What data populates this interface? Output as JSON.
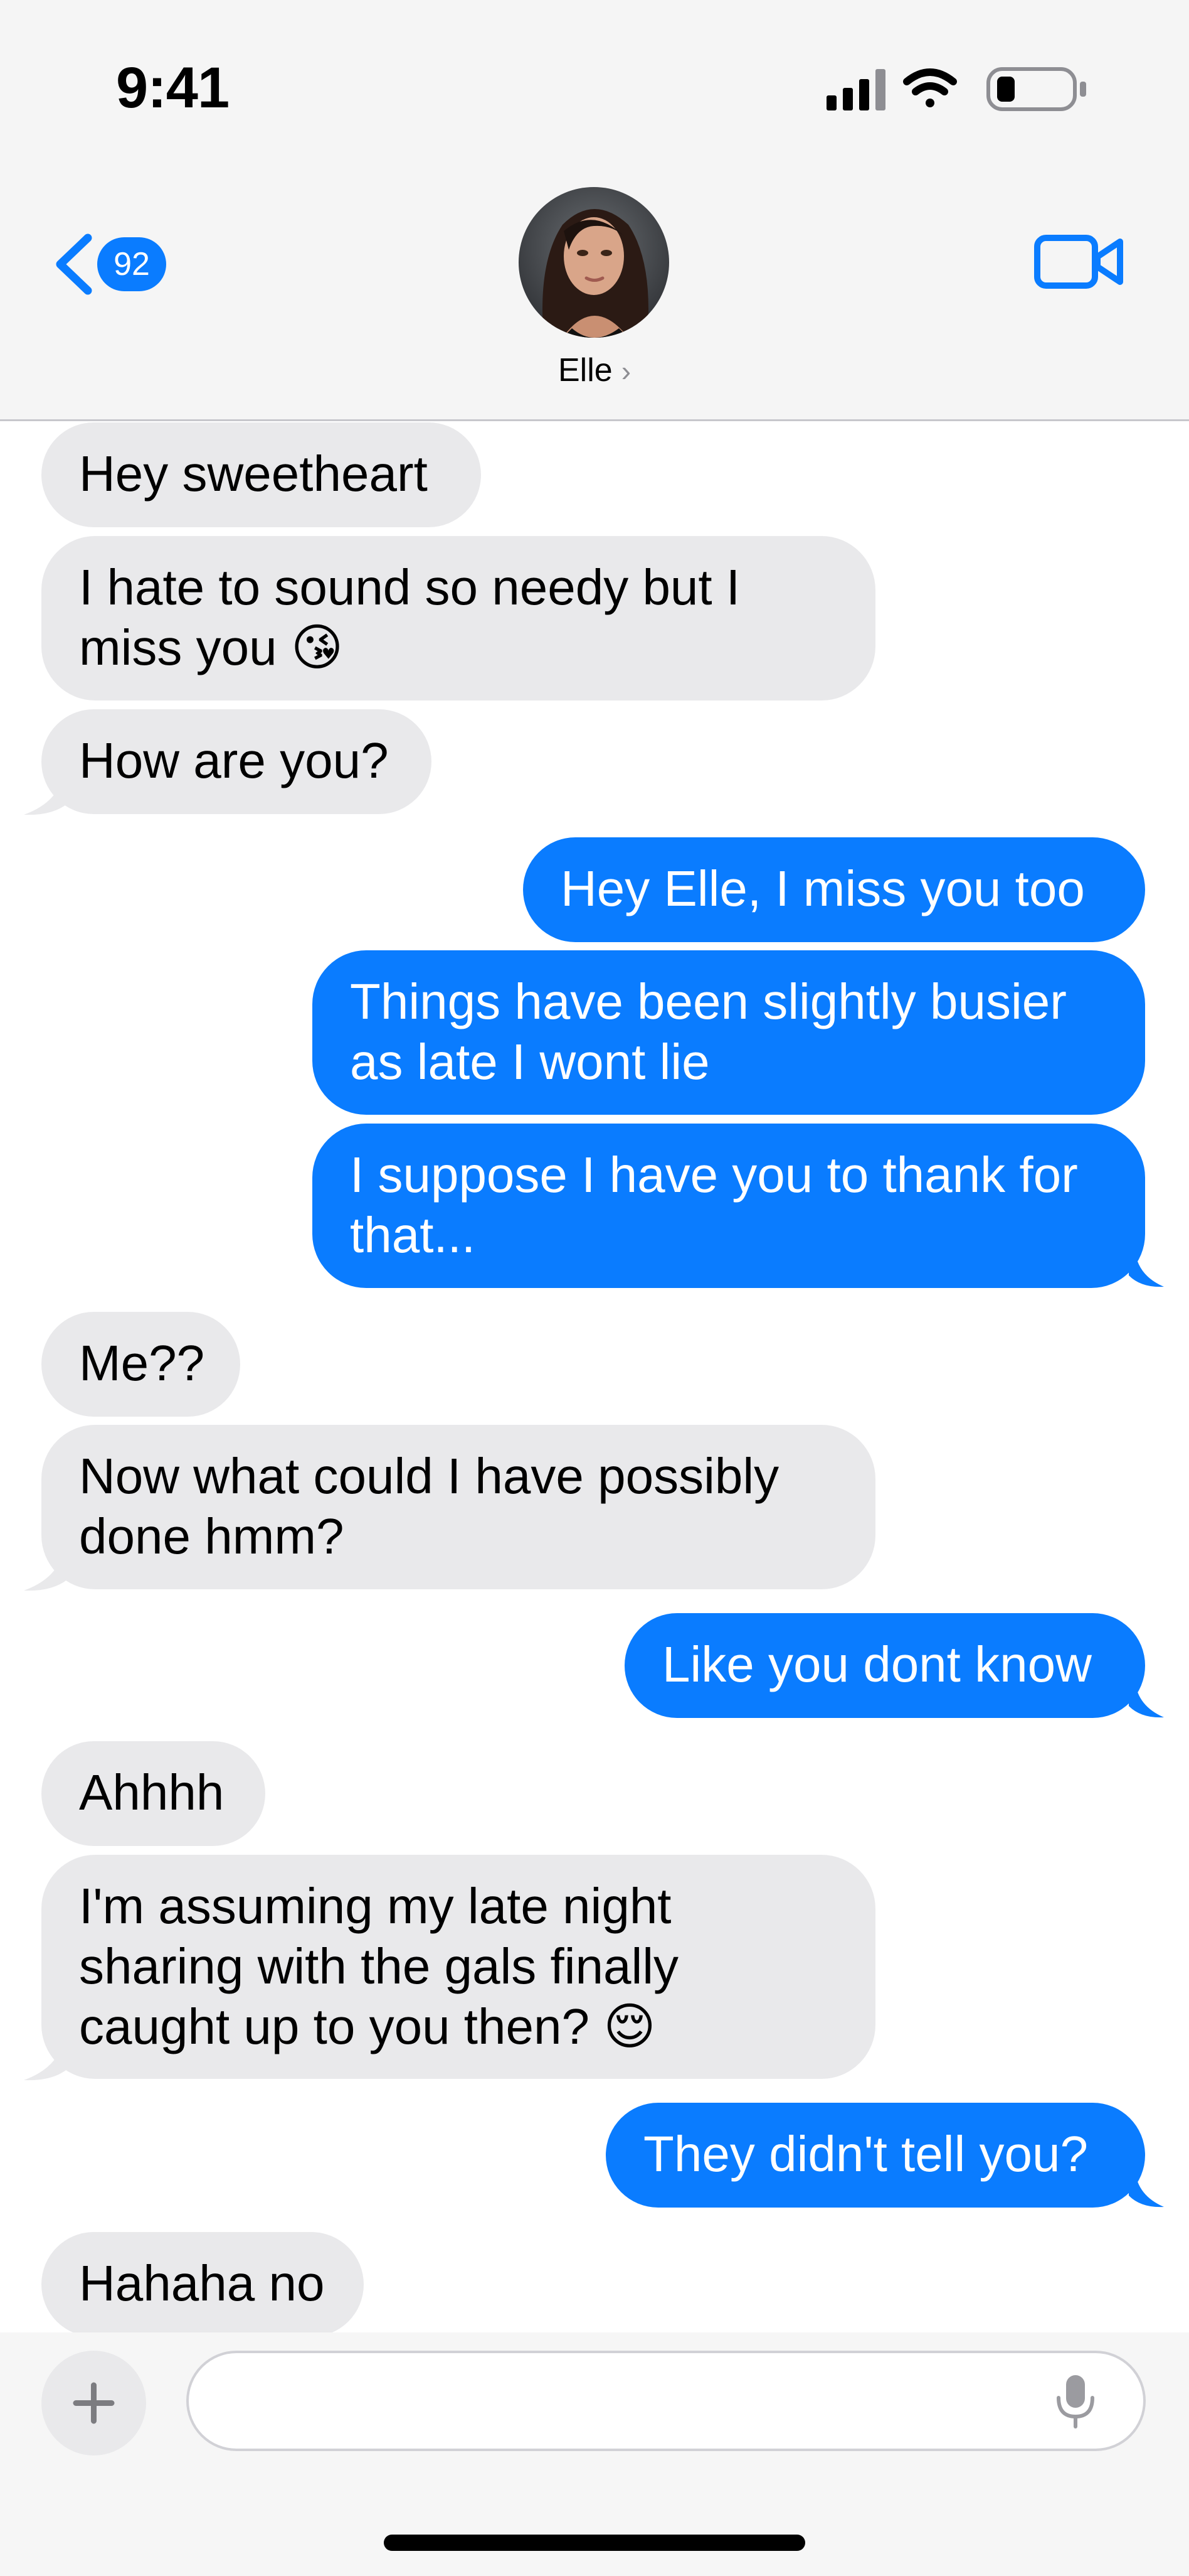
{
  "status_bar": {
    "time": "9:41"
  },
  "nav": {
    "back_badge": "92",
    "contact_name": "Elle",
    "name_chevron": "›",
    "icons": [
      "chevron-left-icon",
      "video-camera-icon",
      "chevron-right-icon"
    ]
  },
  "messages": [
    {
      "from": "them",
      "text": "Hey sweetheart"
    },
    {
      "from": "them",
      "text": "I hate to sound so needy but I miss you 😘"
    },
    {
      "from": "them",
      "text": "How are you?"
    },
    {
      "from": "me",
      "text": "Hey Elle, I miss you too"
    },
    {
      "from": "me",
      "text": "Things have been slightly busier as late I wont lie"
    },
    {
      "from": "me",
      "text": "I suppose I have you to thank for that..."
    },
    {
      "from": "them",
      "text": "Me??"
    },
    {
      "from": "them",
      "text": "Now what could I have possibly done hmm?"
    },
    {
      "from": "me",
      "text": "Like you dont know"
    },
    {
      "from": "them",
      "text": "Ahhhh"
    },
    {
      "from": "them",
      "text": "I'm assuming my late night sharing with the gals finally caught up to you then? 😌"
    },
    {
      "from": "me",
      "text": "They didn't tell you?"
    },
    {
      "from": "them",
      "text": "Hahaha no"
    }
  ],
  "composer": {
    "placeholder": ""
  },
  "colors": {
    "outgoing": "#0a7cff",
    "incoming": "#e9e9eb",
    "header": "#f5f5f5"
  }
}
